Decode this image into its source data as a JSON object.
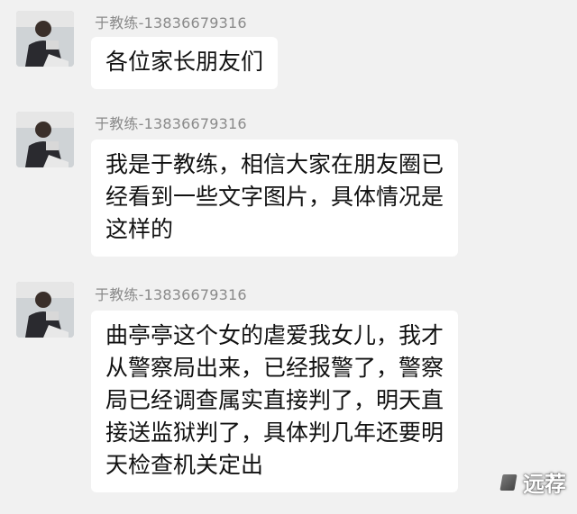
{
  "messages": [
    {
      "sender": "于教练-13836679316",
      "lines": [
        "各位家长朋友们"
      ]
    },
    {
      "sender": "于教练-13836679316",
      "lines": [
        "我是于教练，相信大家在朋友圈已",
        "经看到一些文字图片，具体情况是",
        "这样的"
      ]
    },
    {
      "sender": "于教练-13836679316",
      "lines": [
        "曲亭亭这个女的虐爱我女儿，我才",
        "从警察局出来，已经报警了，警察",
        "局已经调查属实直接判了，明天直",
        "接送监狱判了，具体判几年还要明",
        "天检查机关定出"
      ]
    }
  ],
  "watermark": {
    "text": "远荐"
  },
  "colors": {
    "background": "#f1f1f1",
    "bubble": "#ffffff",
    "sender_text": "#8a8a8a",
    "message_text": "#111111"
  },
  "icons": {
    "avatar": "person-photo-avatar",
    "watermark_mark": "logo-mark"
  }
}
